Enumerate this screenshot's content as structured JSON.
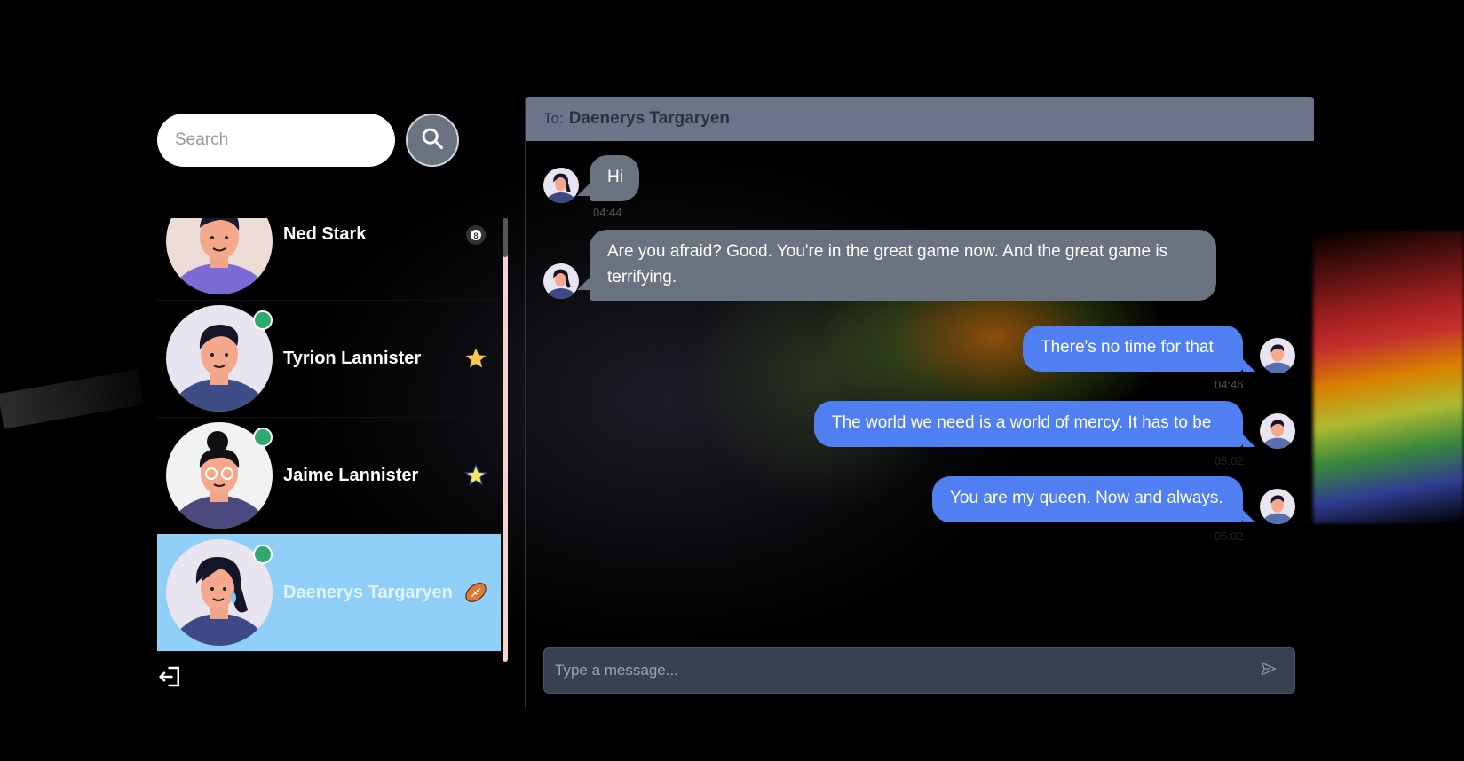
{
  "search": {
    "placeholder": "Search"
  },
  "contacts": [
    {
      "name": "Ned Stark",
      "online": false,
      "icon": "eight-ball-icon",
      "active": false
    },
    {
      "name": "Tyrion Lannister",
      "online": true,
      "icon": "star-icon",
      "active": false
    },
    {
      "name": "Jaime Lannister",
      "online": true,
      "icon": "sparkle-star-icon",
      "active": false
    },
    {
      "name": "Daenerys Targaryen",
      "online": true,
      "icon": "football-icon",
      "active": true
    }
  ],
  "chat": {
    "to_label": "To:",
    "recipient": "Daenerys Targaryen",
    "messages": [
      {
        "direction": "in",
        "text": "Hi",
        "time": "04:44"
      },
      {
        "direction": "in",
        "text": "Are you afraid? Good. You're in the great game now. And the great game is terrifying.",
        "time": ""
      },
      {
        "direction": "out",
        "text": "There's no time for that",
        "time": "04:46"
      },
      {
        "direction": "out",
        "text": "The world we need is a world of mercy. It has to be",
        "time": "05:02"
      },
      {
        "direction": "out",
        "text": "You are my queen. Now and always.",
        "time": "05:02"
      }
    ],
    "composer_placeholder": "Type a message..."
  },
  "colors": {
    "active_contact": "#8fcff8",
    "incoming_bubble": "#6b7280",
    "outgoing_bubble": "#4f7ff0",
    "header": "#6b7488",
    "online": "#2eaa6e"
  }
}
